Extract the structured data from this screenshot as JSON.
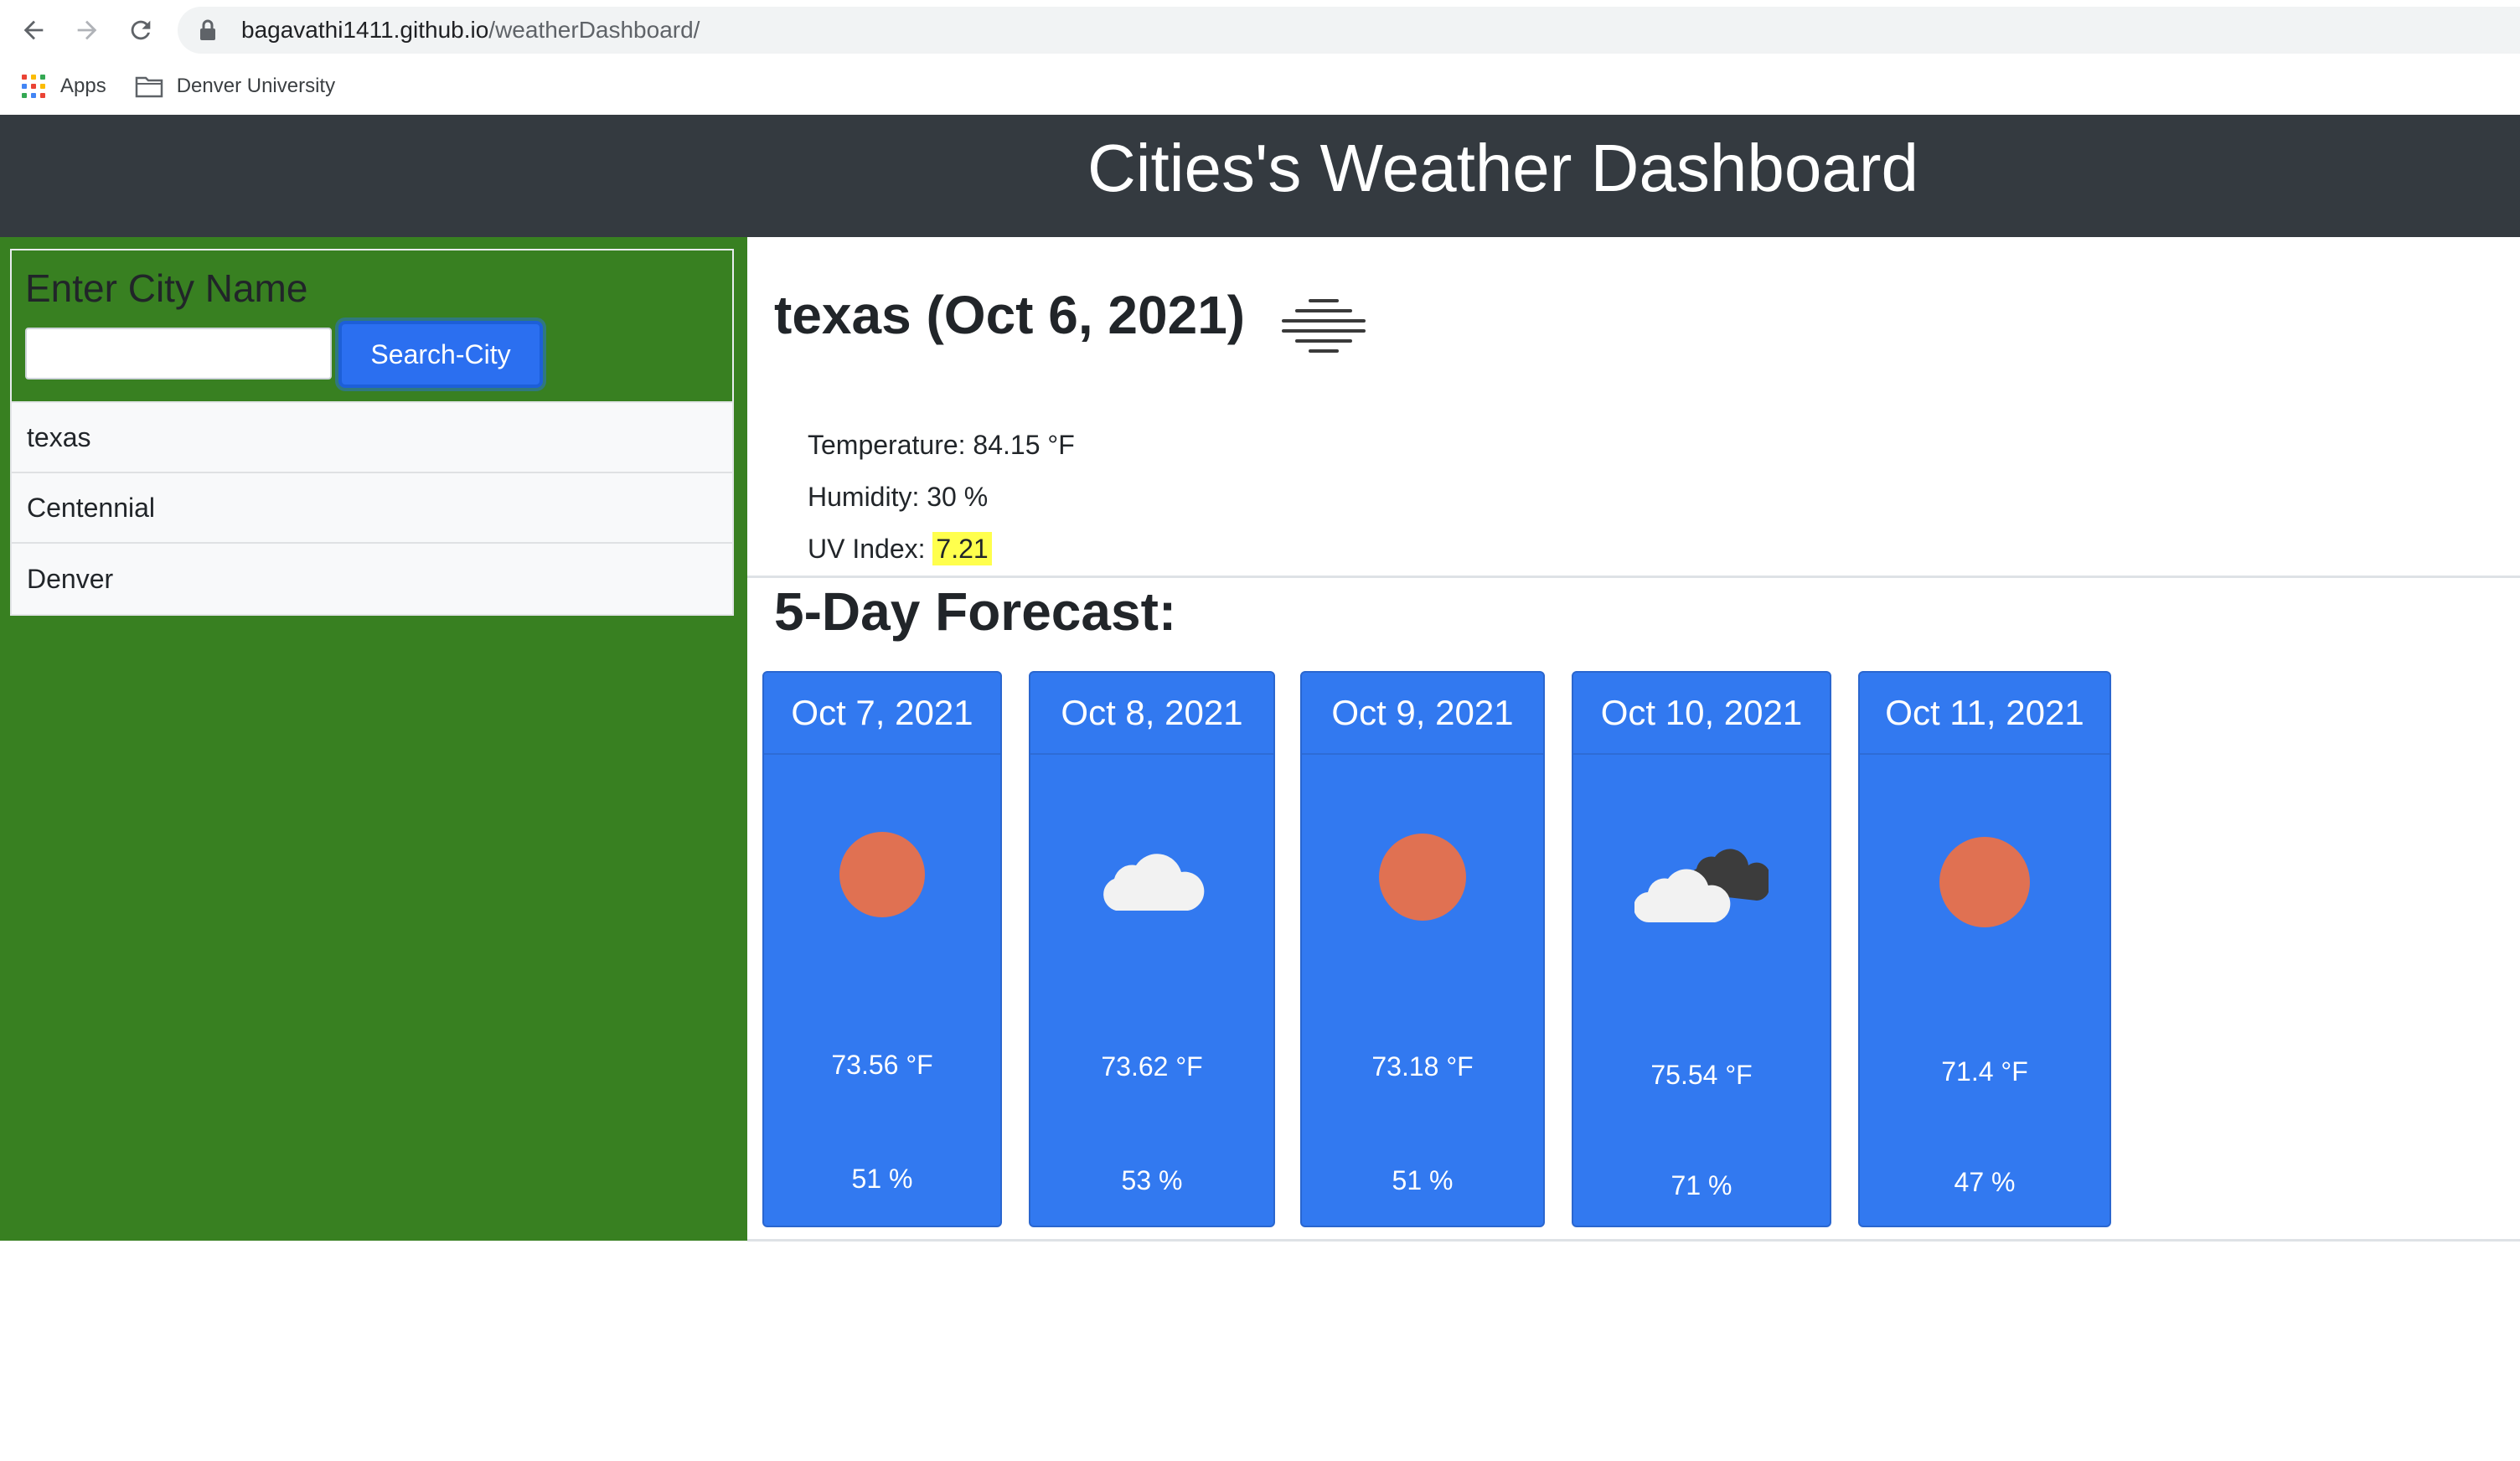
{
  "browser": {
    "url_domain": "bagavathi1411.github.io",
    "url_path": "/weatherDashboard/",
    "bookmarks": [
      {
        "label": "Apps",
        "icon": "apps-grid-icon"
      },
      {
        "label": "Denver University",
        "icon": "folder-icon"
      }
    ]
  },
  "header": {
    "title": "Cities's Weather Dashboard"
  },
  "sidebar": {
    "search_label": "Enter City Name",
    "input_value": "",
    "search_button": "Search-City",
    "cities": [
      "texas",
      "Centennial",
      "Denver"
    ]
  },
  "current": {
    "title": "texas (Oct 6, 2021)",
    "icon": "mist-icon",
    "temperature": "Temperature: 84.15 °F",
    "humidity": "Humidity: 30 %",
    "uv_label": "UV Index: ",
    "uv_value": "7.21"
  },
  "forecast": {
    "title": "5-Day Forecast:",
    "days": [
      {
        "date": "Oct 7, 2021",
        "icon": "sun-icon",
        "temp": "73.56 °F",
        "humidity": "51 %"
      },
      {
        "date": "Oct 8, 2021",
        "icon": "cloud-icon",
        "temp": "73.62 °F",
        "humidity": "53 %"
      },
      {
        "date": "Oct 9, 2021",
        "icon": "sun-icon",
        "temp": "73.18 °F",
        "humidity": "51 %"
      },
      {
        "date": "Oct 10, 2021",
        "icon": "broken-clouds-icon",
        "temp": "75.54 °F",
        "humidity": "71 %"
      },
      {
        "date": "Oct 11, 2021",
        "icon": "sun-icon",
        "temp": "71.4 °F",
        "humidity": "47 %"
      }
    ]
  },
  "colors": {
    "header_bg": "#343a40",
    "sidebar_bg": "#388021",
    "card_bg": "#3279f0",
    "button_bg": "#2b6ff0",
    "uv_highlight": "#ffff4d",
    "sun": "#e07152"
  }
}
